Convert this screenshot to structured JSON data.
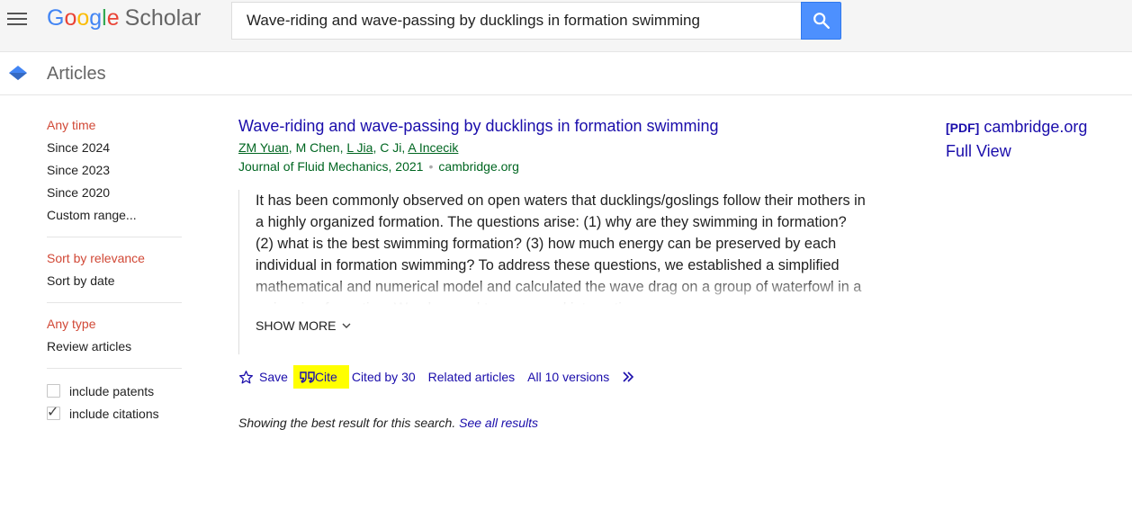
{
  "header": {
    "logo_google": "Google",
    "logo_scholar": "Scholar",
    "search_value": "Wave-riding and wave-passing by ducklings in formation swimming",
    "colors": {
      "blue": "#4285f4",
      "red": "#ea4335",
      "yellow": "#fbbc05",
      "green": "#34a853",
      "search_button": "#4d90fe"
    },
    "icons": {
      "menu": "hamburger-menu-icon",
      "search": "magnifier-icon"
    }
  },
  "subheader": {
    "title": "Articles",
    "icon": "scholar-cap-icon"
  },
  "sidebar": {
    "time_filters": [
      "Any time",
      "Since 2024",
      "Since 2023",
      "Since 2020",
      "Custom range..."
    ],
    "sort_options": [
      "Sort by relevance",
      "Sort by date"
    ],
    "type_filters": [
      "Any type",
      "Review articles"
    ],
    "checkboxes": [
      {
        "label": "include patents",
        "checked": false
      },
      {
        "label": "include citations",
        "checked": true
      }
    ],
    "active_color": "#d14836"
  },
  "result": {
    "title": "Wave-riding and wave-passing by ducklings in formation swimming",
    "authors": [
      {
        "name": "ZM Yuan",
        "linked": true
      },
      {
        "name": "M Chen",
        "linked": false
      },
      {
        "name": "L Jia",
        "linked": true
      },
      {
        "name": "C Ji",
        "linked": false
      },
      {
        "name": "A Incecik",
        "linked": true
      }
    ],
    "venue": "Journal of Fluid Mechanics, 2021",
    "source_domain": "cambridge.org",
    "snippet": "It has been commonly observed on open waters that ducklings/goslings follow their mothers in a highly organized formation. The questions arise: (1) why are they swimming in formation? (2) what is the best swimming formation? (3) how much energy can be preserved by each individual in formation swimming? To address these questions, we established a simplified mathematical and numerical model and calculated the wave drag on a group of waterfowl in a swimming formation. We observed two new and interesting",
    "show_more": "SHOW MORE",
    "actions": {
      "save": "Save",
      "cite": "Cite",
      "cited_by": "Cited by 30",
      "related": "Related articles",
      "versions": "All 10 versions"
    },
    "highlight_color": "#ffff00"
  },
  "side_link": {
    "pdf_tag": "[PDF]",
    "domain": "cambridge.org",
    "full_view": "Full View"
  },
  "best_note": {
    "text": "Showing the best result for this search.",
    "see_all": "See all results"
  }
}
